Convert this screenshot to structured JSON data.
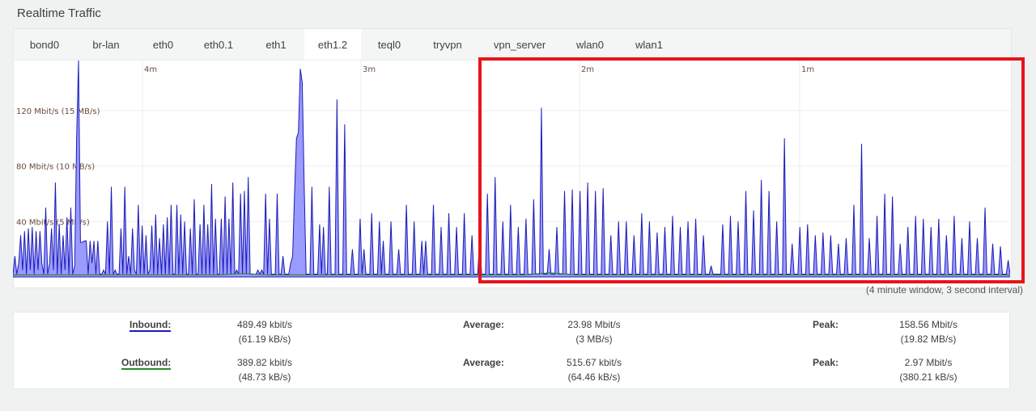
{
  "page_title": "Realtime Traffic",
  "tabs": [
    {
      "label": "bond0",
      "active": false
    },
    {
      "label": "br-lan",
      "active": false
    },
    {
      "label": "eth0",
      "active": false
    },
    {
      "label": "eth0.1",
      "active": false
    },
    {
      "label": "eth1",
      "active": false
    },
    {
      "label": "eth1.2",
      "active": true
    },
    {
      "label": "teql0",
      "active": false
    },
    {
      "label": "tryvpn",
      "active": false
    },
    {
      "label": "vpn_server",
      "active": false
    },
    {
      "label": "wlan0",
      "active": false
    },
    {
      "label": "wlan1",
      "active": false
    }
  ],
  "chart_data": {
    "type": "area",
    "y_ticks": [
      "40 Mbit/s (5 MB/s)",
      "80 Mbit/s (10 MB/s)",
      "120 Mbit/s (15 MB/s)"
    ],
    "y_tick_values": [
      40,
      80,
      120
    ],
    "ylim": [
      0,
      156
    ],
    "x_ticks": [
      "4m",
      "3m",
      "2m",
      "1m"
    ],
    "grid": true,
    "colors": {
      "inbound": "#1b1bb7",
      "inbound_fill": "#9a9aff",
      "outbound": "#2a8a2a"
    },
    "series": [
      {
        "name": "Inbound",
        "values": [
          2,
          15,
          2,
          10,
          30,
          5,
          33,
          2,
          35,
          5,
          36,
          2,
          33,
          5,
          33,
          10,
          2,
          50,
          2,
          10,
          35,
          5,
          68,
          2,
          38,
          2,
          30,
          5,
          43,
          2,
          50,
          2,
          8,
          100,
          156,
          25,
          25,
          26,
          26,
          2,
          26,
          10,
          26,
          2,
          26,
          2,
          2,
          5,
          2,
          40,
          2,
          65,
          2,
          5,
          2,
          2,
          35,
          2,
          65,
          2,
          15,
          2,
          35,
          5,
          2,
          52,
          2,
          37,
          2,
          30,
          2,
          5,
          37,
          2,
          45,
          2,
          28,
          2,
          38,
          2,
          43,
          2,
          52,
          2,
          2,
          52,
          2,
          45,
          2,
          40,
          2,
          2,
          35,
          2,
          56,
          2,
          2,
          38,
          2,
          52,
          2,
          38,
          2,
          67,
          2,
          42,
          2,
          2,
          42,
          2,
          58,
          2,
          42,
          2,
          68,
          2,
          5,
          2,
          60,
          2,
          62,
          2,
          72,
          2,
          2,
          2,
          2,
          5,
          2,
          5,
          2,
          60,
          2,
          42,
          2,
          2,
          2,
          60,
          2,
          2,
          15,
          2,
          2,
          2,
          10,
          15,
          60,
          100,
          104,
          150,
          140,
          66,
          2,
          2,
          2,
          65,
          2,
          2,
          2,
          38,
          2,
          36,
          2,
          2,
          65,
          2,
          2,
          2,
          128,
          2,
          2,
          2,
          110,
          2,
          2,
          2,
          20,
          2,
          2,
          2,
          42,
          2,
          20,
          2,
          2,
          2,
          46,
          2,
          2,
          2,
          40,
          2,
          26,
          2,
          2,
          2,
          40,
          2,
          2,
          2,
          20,
          2,
          2,
          2,
          52,
          2,
          2,
          2,
          40,
          2,
          2,
          2,
          26,
          2,
          26,
          2,
          2,
          2,
          52,
          2,
          2,
          2,
          36,
          2,
          2,
          2,
          46,
          2,
          2,
          2,
          36,
          2,
          2,
          2,
          46,
          2,
          2,
          2,
          30,
          2,
          2,
          2,
          30,
          2,
          2,
          2,
          60,
          2,
          2,
          2,
          72,
          2,
          2,
          2,
          40,
          2,
          2,
          2,
          52,
          2,
          2,
          2,
          36,
          2,
          2,
          2,
          42,
          2,
          2,
          2,
          56,
          2,
          2,
          2,
          122,
          2,
          2,
          2,
          20,
          2,
          2,
          2,
          36,
          2,
          2,
          2,
          62,
          2,
          2,
          2,
          63,
          2,
          2,
          2,
          62,
          2,
          2,
          2,
          68,
          2,
          2,
          2,
          62,
          2,
          2,
          2,
          64,
          2,
          2,
          2,
          30,
          2,
          2,
          2,
          40,
          2,
          2,
          2,
          40,
          2,
          2,
          2,
          30,
          2,
          2,
          2,
          46,
          2,
          2,
          2,
          40,
          2,
          2,
          2,
          32,
          2,
          2,
          2,
          36,
          2,
          2,
          2,
          44,
          2,
          2,
          2,
          36,
          2,
          2,
          2,
          40,
          2,
          2,
          2,
          42,
          2,
          2,
          2,
          30,
          2,
          2,
          2,
          8,
          2,
          2,
          2,
          2,
          2,
          38,
          2,
          2,
          2,
          44,
          2,
          2,
          2,
          40,
          2,
          2,
          2,
          62,
          2,
          2,
          2,
          48,
          2,
          2,
          2,
          70,
          2,
          2,
          2,
          62,
          2,
          2,
          2,
          40,
          2,
          2,
          2,
          100,
          2,
          2,
          2,
          24,
          2,
          2,
          2,
          36,
          2,
          2,
          2,
          38,
          2,
          2,
          2,
          30,
          2,
          2,
          2,
          32,
          2,
          2,
          2,
          30,
          2,
          2,
          2,
          24,
          2,
          2,
          2,
          28,
          2,
          2,
          2,
          52,
          2,
          2,
          2,
          96,
          2,
          2,
          2,
          28,
          2,
          2,
          2,
          44,
          2,
          2,
          2,
          60,
          2,
          2,
          2,
          58,
          2,
          2,
          2,
          24,
          2,
          2,
          2,
          36,
          2,
          2,
          2,
          44,
          2,
          2,
          2,
          42,
          2,
          2,
          2,
          36,
          2,
          2,
          2,
          42,
          2,
          2,
          2,
          30,
          2,
          2,
          2,
          44,
          2,
          2,
          2,
          28,
          2,
          2,
          2,
          40,
          2,
          2,
          2,
          28,
          2,
          2,
          2,
          50,
          2,
          2,
          2,
          24,
          2,
          2,
          2,
          22,
          2,
          2,
          2,
          12,
          2
        ]
      },
      {
        "name": "Outbound",
        "values": [
          1.5,
          1.5,
          1.5,
          1.5,
          1.5,
          1.5,
          1.5,
          1.5,
          1.5,
          2.5,
          1.5,
          1.5,
          1.5,
          1.5,
          1.5,
          1.5,
          1.5,
          1.5,
          1.5,
          1.5,
          1.5,
          3,
          1.5,
          1.5,
          1.5,
          1.5,
          1.5,
          1.5,
          1.5,
          1.5,
          1.5,
          1.5,
          1.5,
          1.5,
          1.5,
          1.5,
          1.5,
          1.5,
          1.5,
          1.5
        ]
      }
    ]
  },
  "window_note": "(4 minute window, 3 second interval)",
  "stats": {
    "inbound": {
      "label": "Inbound:",
      "current": "489.49 kbit/s",
      "current_sub": "(61.19 kB/s)",
      "average_label": "Average:",
      "average": "23.98 Mbit/s",
      "average_sub": "(3 MB/s)",
      "peak_label": "Peak:",
      "peak": "158.56 Mbit/s",
      "peak_sub": "(19.82 MB/s)"
    },
    "outbound": {
      "label": "Outbound:",
      "current": "389.82 kbit/s",
      "current_sub": "(48.73 kB/s)",
      "average_label": "Average:",
      "average": "515.67 kbit/s",
      "average_sub": "(64.46 kB/s)",
      "peak_label": "Peak:",
      "peak": "2.97 Mbit/s",
      "peak_sub": "(380.21 kB/s)"
    }
  }
}
